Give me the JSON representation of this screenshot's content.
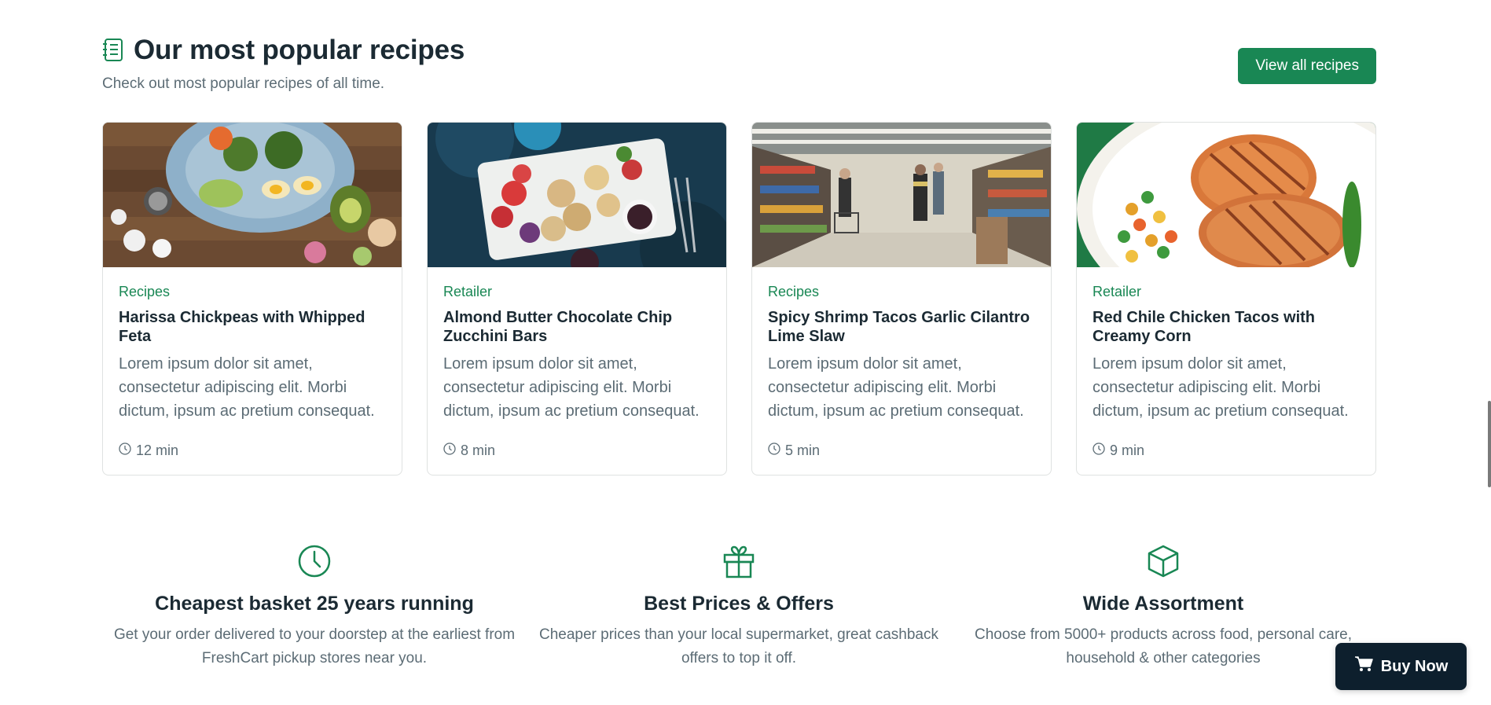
{
  "header": {
    "title": "Our most popular recipes",
    "subtitle": "Check out most popular recipes of all time.",
    "view_all_label": "View all recipes",
    "icon": "recipe-book-icon"
  },
  "cards": [
    {
      "category": "Recipes",
      "title": "Harissa Chickpeas with Whipped Feta",
      "text": "Lorem ipsum dolor sit amet, consectetur adipiscing elit. Morbi dictum, ipsum ac pretium consequat.",
      "time": "12 min",
      "image": "salad-bowl-photo"
    },
    {
      "category": "Retailer",
      "title": "Almond Butter Chocolate Chip Zucchini Bars",
      "text": "Lorem ipsum dolor sit amet, consectetur adipiscing elit. Morbi dictum, ipsum ac pretium consequat.",
      "time": "8 min",
      "image": "cracker-platter-photo"
    },
    {
      "category": "Recipes",
      "title": "Spicy Shrimp Tacos Garlic Cilantro Lime Slaw",
      "text": "Lorem ipsum dolor sit amet, consectetur adipiscing elit. Morbi dictum, ipsum ac pretium consequat.",
      "time": "5 min",
      "image": "supermarket-aisle-photo"
    },
    {
      "category": "Retailer",
      "title": "Red Chile Chicken Tacos with Creamy Corn",
      "text": "Lorem ipsum dolor sit amet, consectetur adipiscing elit. Morbi dictum, ipsum ac pretium consequat.",
      "time": "9 min",
      "image": "grilled-chicken-photo"
    }
  ],
  "features": [
    {
      "icon": "clock-icon",
      "title": "Cheapest basket 25 years running",
      "text": "Get your order delivered to your doorstep at the earliest from FreshCart pickup stores near you."
    },
    {
      "icon": "gift-icon",
      "title": "Best Prices & Offers",
      "text": "Cheaper prices than your local supermarket, great cashback offers to top it off."
    },
    {
      "icon": "box-icon",
      "title": "Wide Assortment",
      "text": "Choose from 5000+ products across food, personal care, household & other categories"
    }
  ],
  "buy_now": {
    "label": "Buy Now",
    "icon": "cart-icon"
  },
  "colors": {
    "accent": "#198754",
    "dark": "#0d1f2d",
    "muted": "#5c6c75"
  }
}
